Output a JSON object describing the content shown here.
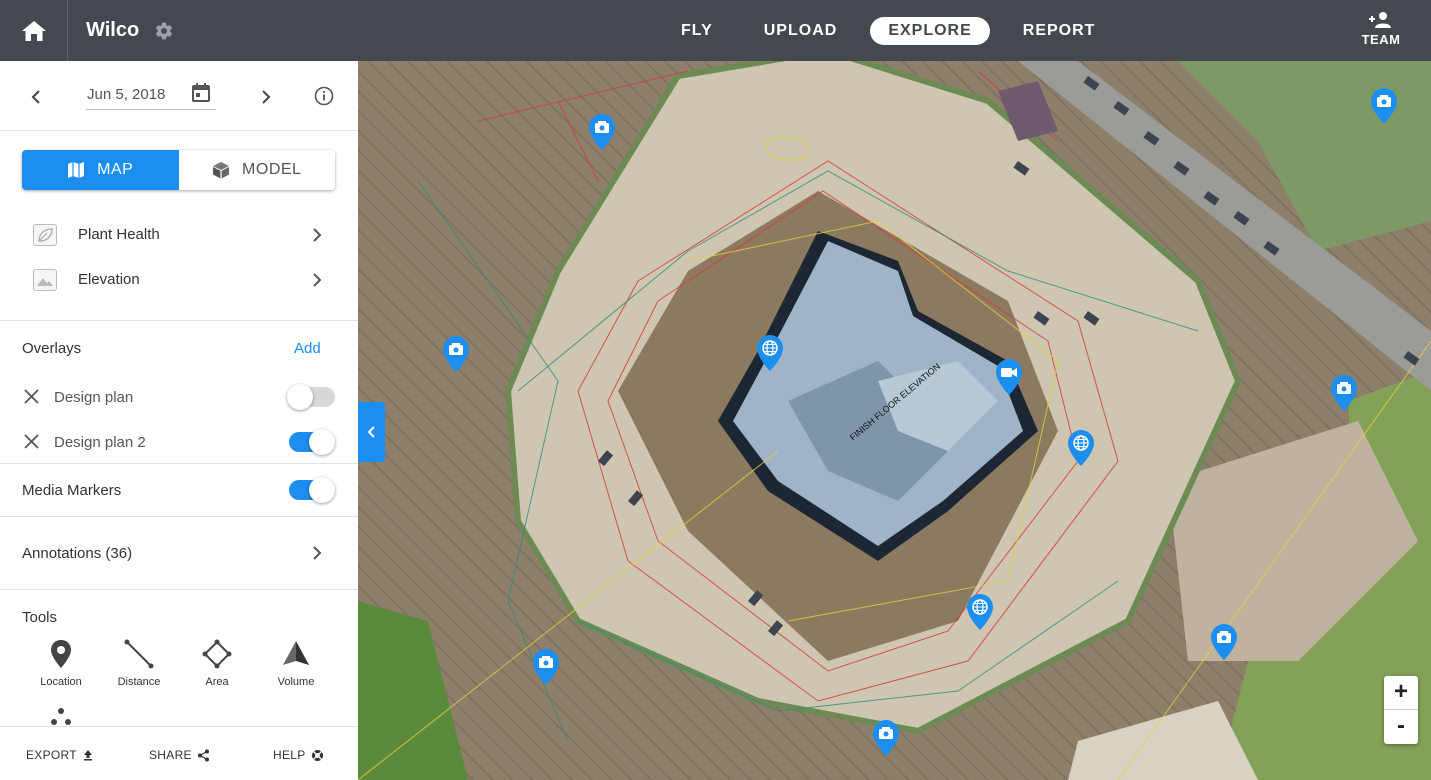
{
  "header": {
    "project_name": "Wilco",
    "nav_tabs": [
      {
        "label": "FLY",
        "active": false
      },
      {
        "label": "UPLOAD",
        "active": false
      },
      {
        "label": "EXPLORE",
        "active": true
      },
      {
        "label": "REPORT",
        "active": false
      }
    ],
    "team_label": "TEAM"
  },
  "sidebar": {
    "date": "Jun 5, 2018",
    "view_toggle": {
      "map_label": "MAP",
      "model_label": "MODEL",
      "active": "MAP"
    },
    "layers": [
      {
        "label": "Plant Health",
        "icon": "leaf-icon"
      },
      {
        "label": "Elevation",
        "icon": "mountain-icon"
      }
    ],
    "overlays": {
      "title": "Overlays",
      "add_label": "Add",
      "items": [
        {
          "label": "Design plan",
          "enabled": false
        },
        {
          "label": "Design plan 2",
          "enabled": true
        }
      ]
    },
    "media_markers": {
      "label": "Media Markers",
      "enabled": true
    },
    "annotations": {
      "label": "Annotations (36)"
    },
    "tools": {
      "title": "Tools",
      "items": [
        {
          "label": "Location",
          "icon": "location-pin-icon"
        },
        {
          "label": "Distance",
          "icon": "distance-icon"
        },
        {
          "label": "Area",
          "icon": "area-icon"
        },
        {
          "label": "Volume",
          "icon": "volume-icon"
        }
      ]
    },
    "footer": {
      "export_label": "EXPORT",
      "share_label": "SHARE",
      "help_label": "HELP"
    }
  },
  "map": {
    "overlay_label": "FINISH FLOOR ELEVATION",
    "markers": [
      {
        "type": "camera"
      },
      {
        "type": "camera"
      },
      {
        "type": "camera"
      },
      {
        "type": "camera"
      },
      {
        "type": "camera"
      },
      {
        "type": "camera"
      },
      {
        "type": "camera"
      },
      {
        "type": "globe"
      },
      {
        "type": "globe"
      },
      {
        "type": "globe"
      },
      {
        "type": "video"
      }
    ],
    "zoom_in_label": "+",
    "zoom_out_label": "-"
  },
  "colors": {
    "accent": "#1b8ef0",
    "topbar": "#43494e"
  }
}
